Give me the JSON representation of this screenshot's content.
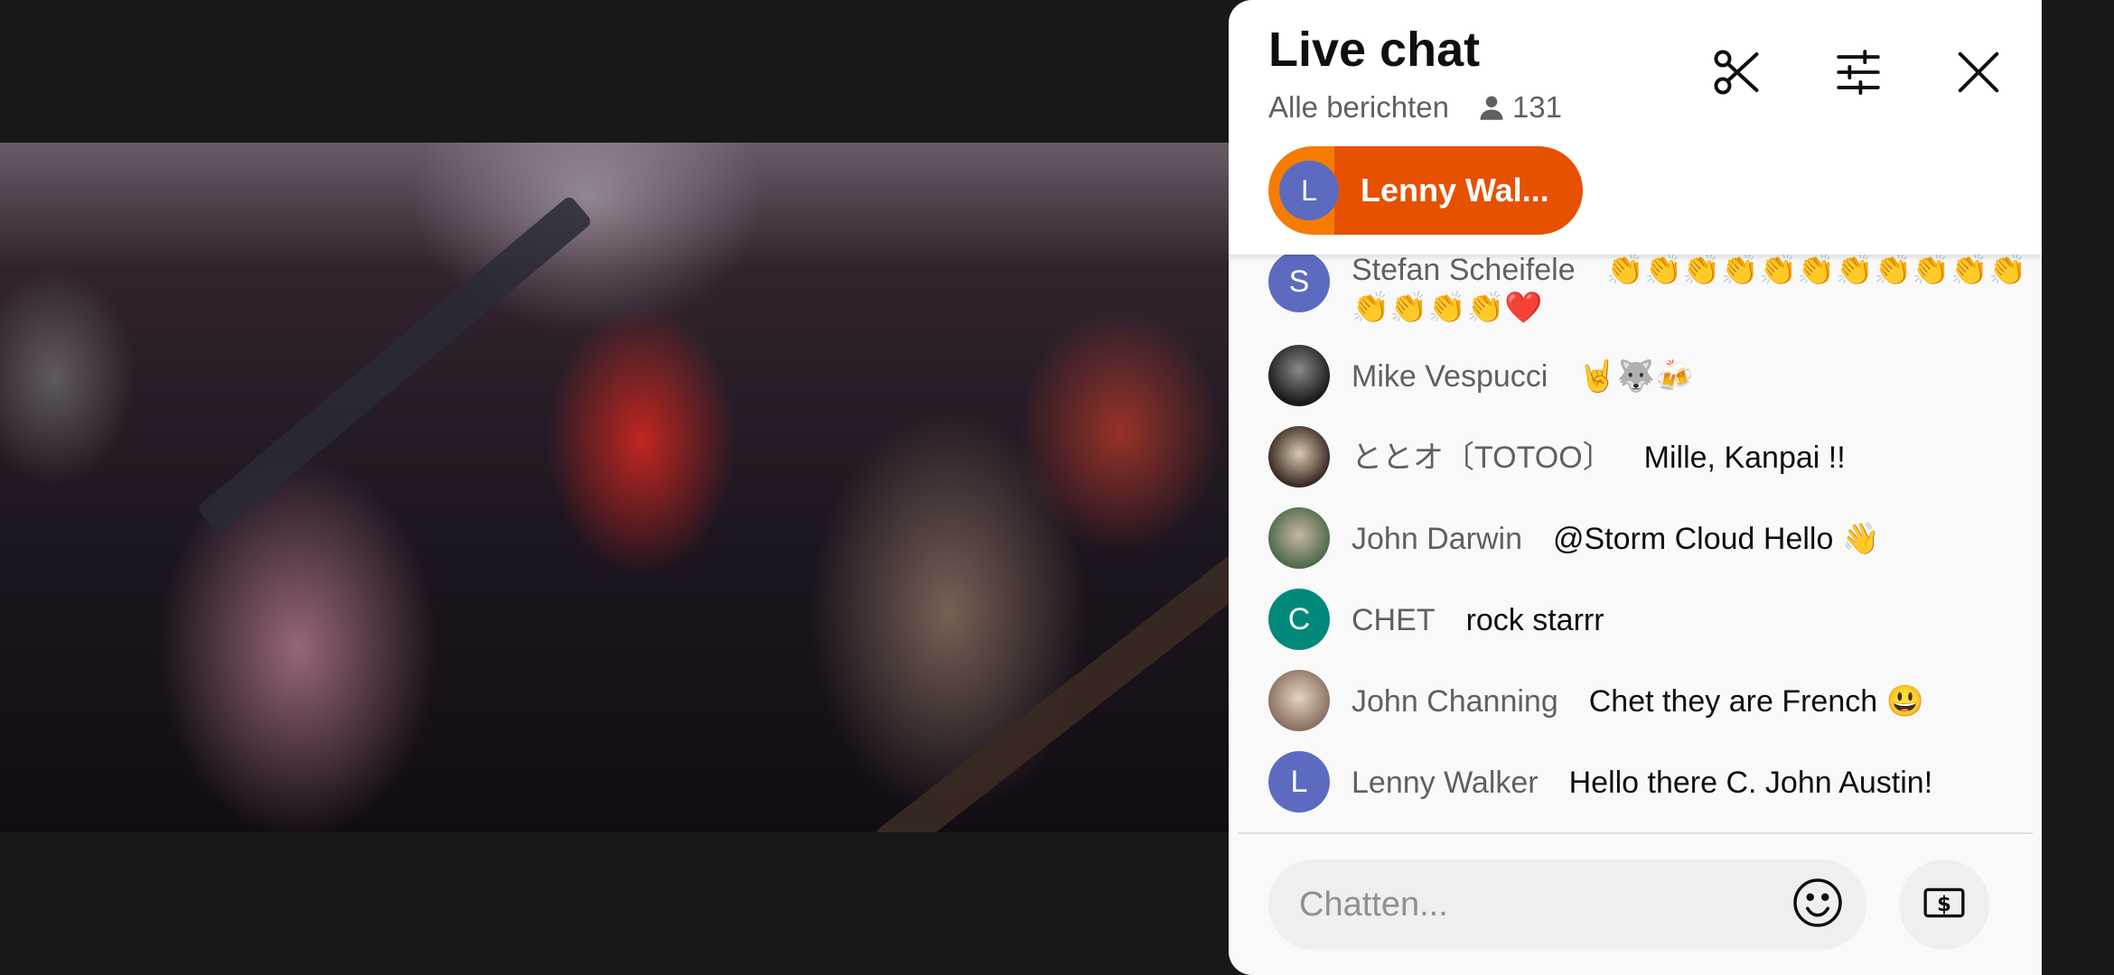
{
  "chat": {
    "title": "Live chat",
    "subtitle": "Alle berichten",
    "viewer_count": "131",
    "icons": {
      "viewers": "person-icon",
      "clip": "scissors-icon",
      "settings": "sliders-icon",
      "close": "close-icon"
    },
    "pinned": {
      "avatar_letter": "L",
      "name": "Lenny Wal..."
    },
    "messages": [
      {
        "avatar": "S",
        "avatar_color": "#5c6bc0",
        "author": "Stefan Scheifele",
        "text": "👏👏👏👏👏👏👏👏👏👏👏👏👏👏👏❤️"
      },
      {
        "avatar": "",
        "avatar_color": "#2b2b2b",
        "author": "Mike Vespucci",
        "text": "🤘🐺🍻"
      },
      {
        "avatar": "",
        "avatar_color": "#4a3a30",
        "author": "ととオ〔TOTOO〕",
        "text": "Mille, Kanpai !!"
      },
      {
        "avatar": "",
        "avatar_color": "#6d7a6a",
        "author": "John Darwin",
        "text": "@Storm Cloud Hello 👋"
      },
      {
        "avatar": "C",
        "avatar_color": "#00897b",
        "author": "CHET",
        "text": "rock starrr"
      },
      {
        "avatar": "",
        "avatar_color": "#b09a88",
        "author": "John Channing",
        "text": "Chet they are French 😃"
      },
      {
        "avatar": "L",
        "avatar_color": "#5c6bc0",
        "author": "Lenny Walker",
        "text": "Hello there C. John Austin!"
      }
    ],
    "input": {
      "placeholder": "Chatten...",
      "emoji_icon": "smiley-icon",
      "super_chat_icon": "money-icon"
    }
  }
}
